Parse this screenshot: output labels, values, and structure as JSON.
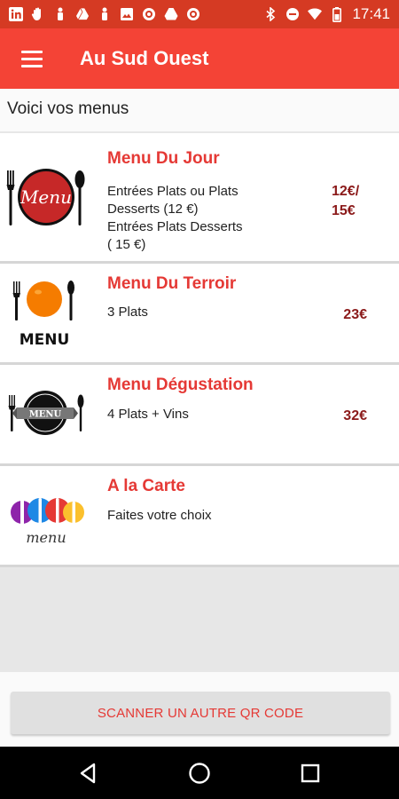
{
  "status_bar": {
    "time": "17:41",
    "left_icons": [
      "linkedin-icon",
      "hand-icon",
      "figure-icon",
      "drive-icon",
      "figure-icon",
      "image-icon",
      "target-icon",
      "drive-icon",
      "target-icon"
    ],
    "right_icons": [
      "bluetooth-icon",
      "do-not-disturb-icon",
      "wifi-icon",
      "battery-icon"
    ]
  },
  "app_bar": {
    "title": "Au Sud Ouest",
    "menu_icon": "hamburger-icon"
  },
  "subheader": "Voici vos menus",
  "menus": [
    {
      "name": "Menu Du Jour",
      "description": [
        "Entrées Plats ou Plats",
        "Desserts (12 €)",
        "Entrées Plats Desserts",
        "( 15 €)"
      ],
      "price": [
        "12€/",
        "15€"
      ],
      "image_icon": "menu-plate-fork-spoon-icon",
      "logo_text": "Menu"
    },
    {
      "name": "Menu Du Terroir",
      "description": [
        "3 Plats"
      ],
      "price": [
        "23€"
      ],
      "image_icon": "menu-orange-plate-icon",
      "logo_text": "MENU"
    },
    {
      "name": "Menu Dégustation",
      "description": [
        "4 Plats + Vins"
      ],
      "price": [
        "32€"
      ],
      "image_icon": "menu-black-plate-icon",
      "logo_text": "MENU"
    },
    {
      "name": "A la Carte",
      "description": [
        "Faites votre choix"
      ],
      "price": [],
      "image_icon": "menu-colorful-utensils-icon",
      "logo_text": "menu"
    }
  ],
  "scan_button": "SCANNER UN AUTRE QR CODE",
  "nav": [
    "back-icon",
    "home-icon",
    "recents-icon"
  ],
  "colors": {
    "status_bar": "#d53a23",
    "app_bar": "#f44336",
    "accent": "#e53935",
    "price": "#8b1a1a"
  }
}
